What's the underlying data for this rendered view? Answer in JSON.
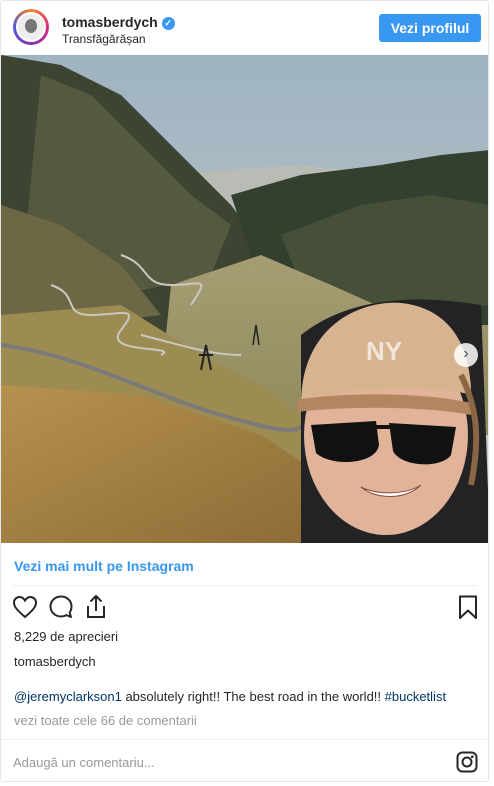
{
  "header": {
    "username": "tomasberdych",
    "verified_mark": "✓",
    "location": "Transfăgărășan",
    "follow_button": "Vezi profilul"
  },
  "photo": {
    "next_arrow": "›",
    "cap_logo": "NY"
  },
  "more_link": "Vezi mai mult pe Instagram",
  "actions": {
    "like_icon": "heart-icon",
    "comment_icon": "comment-icon",
    "share_icon": "share-icon",
    "save_icon": "bookmark-icon"
  },
  "likes": "8,229 de aprecieri",
  "poster_name": "tomasberdych",
  "caption": {
    "mention": "@jeremyclarkson1",
    "text": " absolutely right!! The best road in the world!! ",
    "hashtag": "#bucketlist"
  },
  "comments_link": "vezi toate cele 66 de comentarii",
  "comment_placeholder": "Adaugă un comentariu...",
  "colors": {
    "accent": "#3897f0",
    "link_dark": "#003569",
    "muted": "#999999"
  }
}
